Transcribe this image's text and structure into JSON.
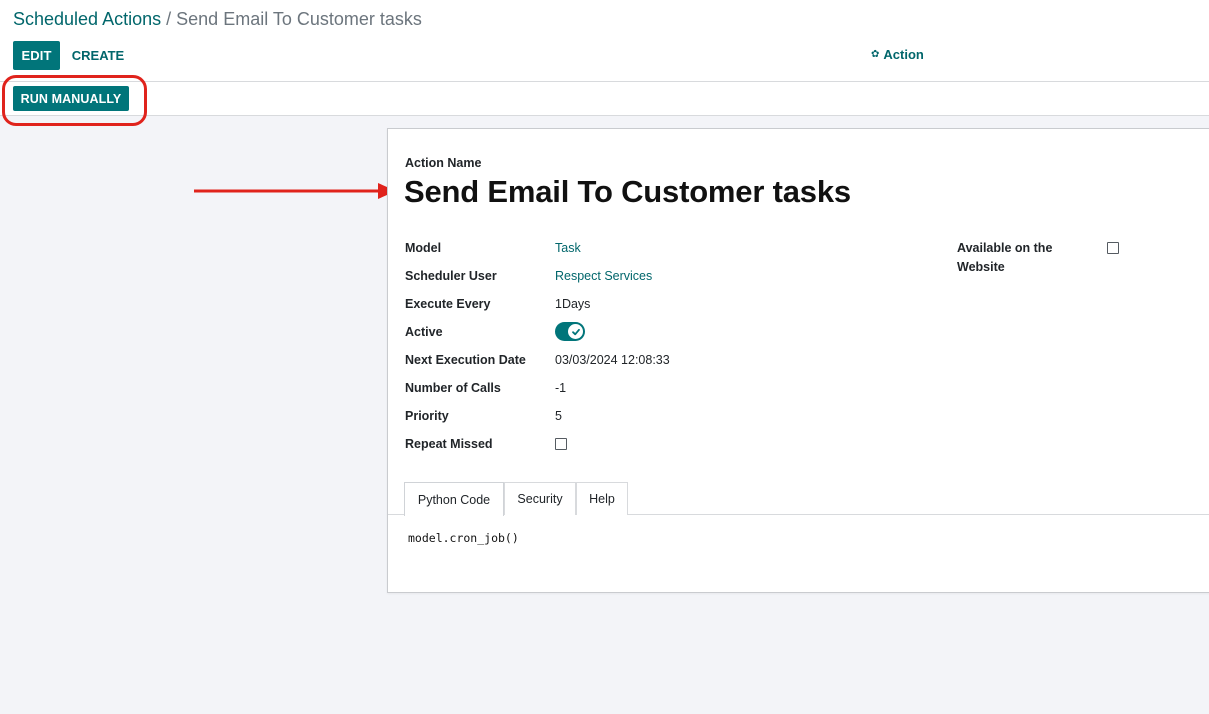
{
  "breadcrumb": {
    "parent": "Scheduled Actions",
    "separator": "/",
    "current": "Send Email To Customer tasks"
  },
  "toolbar": {
    "edit_label": "EDIT",
    "create_label": "CREATE",
    "action_label": "Action",
    "action_icon": "gear-icon"
  },
  "statusbar": {
    "run_manually_label": "RUN MANUALLY"
  },
  "form": {
    "action_name_label": "Action Name",
    "title": "Send Email To Customer tasks",
    "fields": {
      "model": {
        "label": "Model",
        "value": "Task"
      },
      "scheduler_user": {
        "label": "Scheduler User",
        "value": "Respect Services"
      },
      "execute_every": {
        "label": "Execute Every",
        "value": "1Days"
      },
      "active": {
        "label": "Active",
        "checked": true
      },
      "next_execution": {
        "label": "Next Execution Date",
        "value": "03/03/2024 12:08:33"
      },
      "number_of_calls": {
        "label": "Number of Calls",
        "value": "-1"
      },
      "priority": {
        "label": "Priority",
        "value": "5"
      },
      "repeat_missed": {
        "label": "Repeat Missed",
        "checked": false
      }
    },
    "available_on_website": {
      "label": "Available on the Website",
      "checked": false
    }
  },
  "tabs": [
    {
      "label": "Python Code",
      "active": true
    },
    {
      "label": "Security",
      "active": false
    },
    {
      "label": "Help",
      "active": false
    }
  ],
  "code": "model.cron_job()",
  "colors": {
    "primary": "#01757a",
    "link": "#01666b",
    "annotation": "#e0231c"
  }
}
